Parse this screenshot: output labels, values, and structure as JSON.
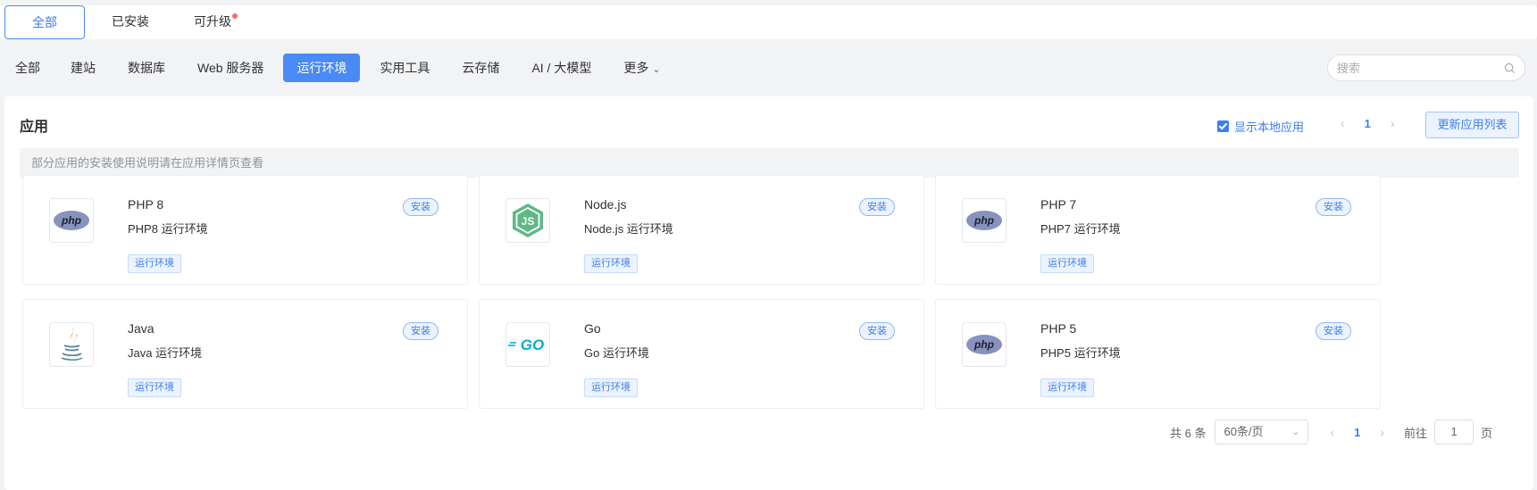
{
  "top_tabs": [
    {
      "label": "全部",
      "active": true
    },
    {
      "label": "已安装",
      "active": false
    },
    {
      "label": "可升级",
      "active": false,
      "dot": true
    }
  ],
  "categories": [
    {
      "label": "全部"
    },
    {
      "label": "建站"
    },
    {
      "label": "数据库"
    },
    {
      "label": "Web 服务器"
    },
    {
      "label": "运行环境",
      "active": true
    },
    {
      "label": "实用工具"
    },
    {
      "label": "云存储"
    },
    {
      "label": "AI / 大模型"
    },
    {
      "label": "更多"
    }
  ],
  "search": {
    "placeholder": "搜索"
  },
  "panel": {
    "title": "应用",
    "show_local_label": "显示本地应用",
    "show_local_checked": true,
    "page": "1",
    "update_button": "更新应用列表",
    "notice": "部分应用的安装使用说明请在应用详情页查看"
  },
  "apps": [
    {
      "name": "PHP 8",
      "desc": "PHP8 运行环境",
      "tag": "运行环境",
      "install": "安装",
      "icon": "php-logo-icon"
    },
    {
      "name": "Node.js",
      "desc": "Node.js 运行环境",
      "tag": "运行环境",
      "install": "安装",
      "icon": "nodejs-logo-icon"
    },
    {
      "name": "PHP 7",
      "desc": "PHP7 运行环境",
      "tag": "运行环境",
      "install": "安装",
      "icon": "php-logo-icon"
    },
    {
      "name": "Java",
      "desc": "Java 运行环境",
      "tag": "运行环境",
      "install": "安装",
      "icon": "java-logo-icon"
    },
    {
      "name": "Go",
      "desc": "Go 运行环境",
      "tag": "运行环境",
      "install": "安装",
      "icon": "go-logo-icon"
    },
    {
      "name": "PHP 5",
      "desc": "PHP5 运行环境",
      "tag": "运行环境",
      "install": "安装",
      "icon": "php-logo-icon"
    }
  ],
  "pagination": {
    "total": "共 6 条",
    "page_size": "60条/页",
    "current": "1",
    "goto_label": "前往",
    "goto_value": "1",
    "page_suffix": "页"
  },
  "colors": {
    "accent": "#4a8af4",
    "php": "#8892bf",
    "node": "#5fb987",
    "go": "#00add8",
    "java_red": "#e76f00",
    "java_blue": "#5382a1"
  }
}
